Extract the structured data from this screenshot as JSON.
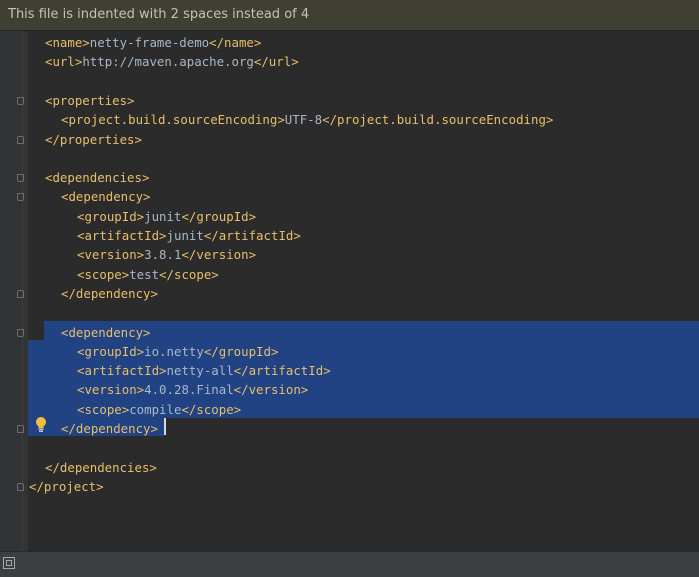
{
  "banner": {
    "message": "This file is indented with 2 spaces instead of 4"
  },
  "editor": {
    "language": "xml",
    "lines": [
      {
        "open": "<name>",
        "text": "netty-frame-demo",
        "close": "</name>"
      },
      {
        "open": "<url>",
        "text": "http://maven.apache.org",
        "close": "</url>"
      },
      {
        "open": "",
        "text": "",
        "close": ""
      },
      {
        "open": "<properties>",
        "text": "",
        "close": ""
      },
      {
        "open": "<project.build.sourceEncoding>",
        "text": "UTF-8",
        "close": "</project.build.sourceEncoding>"
      },
      {
        "open": "",
        "text": "",
        "close": "</properties>"
      },
      {
        "open": "",
        "text": "",
        "close": ""
      },
      {
        "open": "<dependencies>",
        "text": "",
        "close": ""
      },
      {
        "open": "<dependency>",
        "text": "",
        "close": ""
      },
      {
        "open": "<groupId>",
        "text": "junit",
        "close": "</groupId>"
      },
      {
        "open": "<artifactId>",
        "text": "junit",
        "close": "</artifactId>"
      },
      {
        "open": "<version>",
        "text": "3.8.1",
        "close": "</version>"
      },
      {
        "open": "<scope>",
        "text": "test",
        "close": "</scope>"
      },
      {
        "open": "",
        "text": "",
        "close": "</dependency>"
      },
      {
        "open": "",
        "text": "",
        "close": ""
      },
      {
        "open": "<dependency>",
        "text": "",
        "close": ""
      },
      {
        "open": "<groupId>",
        "text": "io.netty",
        "close": "</groupId>"
      },
      {
        "open": "<artifactId>",
        "text": "netty-all",
        "close": "</artifactId>"
      },
      {
        "open": "<version>",
        "text": "4.0.28.Final",
        "close": "</version>"
      },
      {
        "open": "<scope>",
        "text": "compile",
        "close": "</scope>"
      },
      {
        "open": "",
        "text": "",
        "close": "</dependency>"
      },
      {
        "open": "",
        "text": "",
        "close": ""
      },
      {
        "open": "",
        "text": "",
        "close": "</dependencies>"
      },
      {
        "open": "",
        "text": "",
        "close": "</project>"
      }
    ]
  },
  "colors": {
    "tag": "#e8bf6a",
    "text": "#a9b7c6",
    "background": "#2b2b2b",
    "selection": "#214283",
    "banner": "#3f3f33"
  },
  "icons": {
    "intention": "lightbulb-icon",
    "status": "tool-window-icon"
  }
}
